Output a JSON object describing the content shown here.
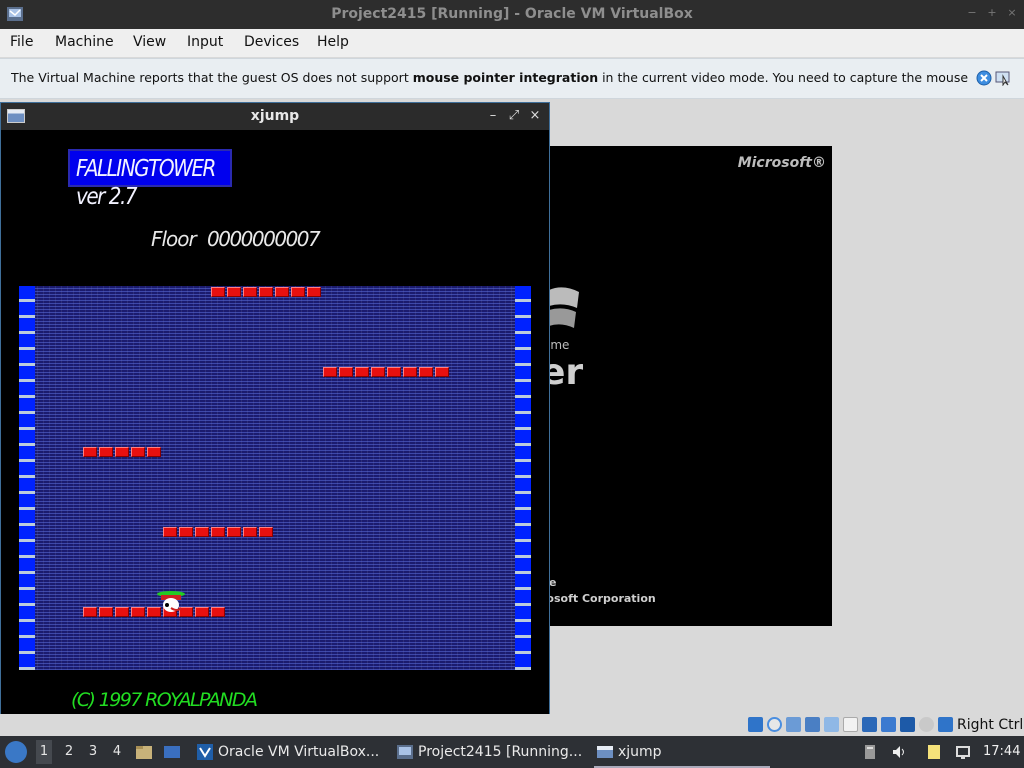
{
  "window": {
    "title": "Project2415 [Running] - Oracle VM VirtualBox",
    "controls": [
      "minimize",
      "maximize",
      "close"
    ]
  },
  "menubar": {
    "items": [
      "File",
      "Machine",
      "View",
      "Input",
      "Devices",
      "Help"
    ]
  },
  "notice": {
    "text_before": "The Virtual Machine reports that the guest OS does not support ",
    "text_bold": "mouse pointer integration",
    "text_after": " in the current video mode. You need to capture the mouse (by clicking"
  },
  "xp_splash": {
    "brand": "Microsoft®",
    "big_text": "er",
    "small_text": "ame",
    "footer1": "e",
    "footer2": "rosoft Corporation"
  },
  "xjump": {
    "title": "xjump",
    "banner": "FALLINGTOWER ver 2.7",
    "floor_label": "Floor",
    "floor_value": "0000000007",
    "copyright": "(C) 1997 ROYALPANDA",
    "colors": {
      "background": "#000000",
      "banner": "#0000ee",
      "ledge": "#e81010",
      "copyright": "#22dd22"
    }
  },
  "statusbar": {
    "icons": [
      "hard-disk-icon",
      "optical-drive-icon",
      "audio-icon",
      "network-icon",
      "usb-icon",
      "shared-folder-icon",
      "display-icon",
      "video-capture-icon",
      "virtualization-icon",
      "mouse-integration-icon",
      "keyboard-capture-icon"
    ],
    "host_key": "Right Ctrl"
  },
  "taskbar": {
    "workspaces": [
      "1",
      "2",
      "3",
      "4"
    ],
    "tasks": [
      {
        "label": "Oracle VM VirtualBox...",
        "icon": "virtualbox-icon"
      },
      {
        "label": "Project2415 [Running...",
        "icon": "virtualbox-vm-icon"
      },
      {
        "label": "xjump",
        "icon": "xjump-icon"
      }
    ],
    "clock": "17:44"
  }
}
